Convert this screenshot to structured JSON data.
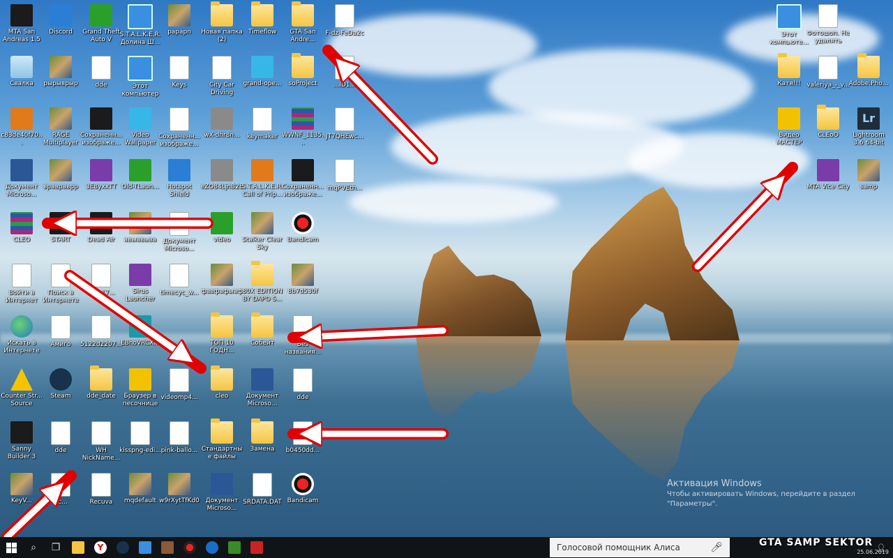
{
  "desktop": {
    "icons_left": [
      {
        "label": "MTA San Andreas 1.5",
        "glyph": "g-dark"
      },
      {
        "label": "Discord",
        "glyph": "g-blue"
      },
      {
        "label": "Grand Theft Auto V",
        "glyph": "g-green"
      },
      {
        "label": "S.T.A.L.K.E.R. Долина Ш...",
        "glyph": "g-monitor"
      },
      {
        "label": "papapn",
        "glyph": "g-img"
      },
      {
        "label": "Новая папка (2)",
        "glyph": "g-folder"
      },
      {
        "label": "Timeflow",
        "glyph": "g-folder"
      },
      {
        "label": "GTA San Andre...",
        "glyph": "g-folder"
      },
      {
        "label": "F-dz-FeDa2c",
        "glyph": "g-file"
      },
      {
        "label": "Свалка",
        "glyph": "g-recycle"
      },
      {
        "label": "рырыврыр",
        "glyph": "g-img"
      },
      {
        "label": "dde",
        "glyph": "g-file"
      },
      {
        "label": "Этот компьютер",
        "glyph": "g-monitor"
      },
      {
        "label": "Keys",
        "glyph": "g-file"
      },
      {
        "label": "City Car Driving",
        "glyph": "g-file"
      },
      {
        "label": "grand-ope...",
        "glyph": "g-cyan"
      },
      {
        "label": "soProject",
        "glyph": "g-folder"
      },
      {
        "label": "...ID1...",
        "glyph": "g-file"
      },
      {
        "label": "c83de40f70...",
        "glyph": "g-orange"
      },
      {
        "label": "RAGE Multiplayer",
        "glyph": "g-img"
      },
      {
        "label": "Сохраненн... изображе...",
        "glyph": "g-dark"
      },
      {
        "label": "Video Wallpaper",
        "glyph": "g-cyan"
      },
      {
        "label": "Сохраненн... изображе...",
        "glyph": "g-file"
      },
      {
        "label": "wX-dhr8n...",
        "glyph": "g-gray"
      },
      {
        "label": "keymaker",
        "glyph": "g-file"
      },
      {
        "label": "WWNF_1135...",
        "glyph": "g-winrar"
      },
      {
        "label": "JT7QHEwc...",
        "glyph": "g-file"
      },
      {
        "label": "Документ Microso...",
        "glyph": "g-word"
      },
      {
        "label": "вравраврр",
        "glyph": "g-img"
      },
      {
        "label": "3E8yxxTT",
        "glyph": "g-purple"
      },
      {
        "label": "Old-TLaun...",
        "glyph": "g-green"
      },
      {
        "label": "Hotspot Shield",
        "glyph": "g-blue"
      },
      {
        "label": "eZO84LjnB2E",
        "glyph": "g-gray"
      },
      {
        "label": "S.T.A.L.K.E.R. Call of Prip...",
        "glyph": "g-orange"
      },
      {
        "label": "Сохраненн... изображе...",
        "glyph": "g-dark"
      },
      {
        "label": "rnqPVEth...",
        "glyph": "g-file"
      },
      {
        "label": "CLEO",
        "glyph": "g-winrar"
      },
      {
        "label": "START",
        "glyph": "g-dark"
      },
      {
        "label": "Dead Air",
        "glyph": "g-dark"
      },
      {
        "label": "авыавыва",
        "glyph": "g-img"
      },
      {
        "label": "Документ Microso...",
        "glyph": "g-file"
      },
      {
        "label": "video",
        "glyph": "g-green"
      },
      {
        "label": "Stalker Clear Sky",
        "glyph": "g-img"
      },
      {
        "label": "Bandicam",
        "glyph": "g-bandicam"
      },
      {
        "label": "Войти в Интернет",
        "glyph": "g-file"
      },
      {
        "label": "Поиск в Интернете",
        "glyph": "g-file"
      },
      {
        "label": "Sh...17...",
        "glyph": "g-file"
      },
      {
        "label": "Sirus Launcher",
        "glyph": "g-purple"
      },
      {
        "label": "timecyc_w...",
        "glyph": "g-file"
      },
      {
        "label": "фавфафыаф",
        "glyph": "g-img"
      },
      {
        "label": "80X EDITION BY DAPO S...",
        "glyph": "g-folder"
      },
      {
        "label": "8b7d530f",
        "glyph": "g-img"
      },
      {
        "label": "Искать в Интернете",
        "glyph": "g-globe"
      },
      {
        "label": "Амиго",
        "glyph": "g-file"
      },
      {
        "label": "5122d2207...",
        "glyph": "g-file"
      },
      {
        "label": "EBhoVRCX...",
        "glyph": "g-teal"
      },
      {
        "label": "ТОП 10 ГОДН...",
        "glyph": "g-folder"
      },
      {
        "label": "Собейт",
        "glyph": "g-folder"
      },
      {
        "label": "Без названия...",
        "glyph": "g-file"
      },
      {
        "label": "Counter Str... Source",
        "glyph": "g-warn"
      },
      {
        "label": "Steam",
        "glyph": "g-steam"
      },
      {
        "label": "dde_date",
        "glyph": "g-folder"
      },
      {
        "label": "Браузер в песочнице",
        "glyph": "g-yellow"
      },
      {
        "label": "videomp4...",
        "glyph": "g-file"
      },
      {
        "label": "cleo",
        "glyph": "g-folder"
      },
      {
        "label": "Документ Microso...",
        "glyph": "g-word"
      },
      {
        "label": "dde",
        "glyph": "g-aiff"
      },
      {
        "label": "Sanny Builder 3",
        "glyph": "g-dark"
      },
      {
        "label": "dde",
        "glyph": "g-file"
      },
      {
        "label": "WH NickName...",
        "glyph": "g-file"
      },
      {
        "label": "kisspng-edi...",
        "glyph": "g-file"
      },
      {
        "label": "pink-ballo...",
        "glyph": "g-file"
      },
      {
        "label": "Стандартные файлы",
        "glyph": "g-folder"
      },
      {
        "label": "Замена",
        "glyph": "g-folder"
      },
      {
        "label": "b0450dd...",
        "glyph": "g-file"
      },
      {
        "label": "KeyV...",
        "glyph": "g-img"
      },
      {
        "label": "dc...",
        "glyph": "g-file"
      },
      {
        "label": "Recuva",
        "glyph": "g-file"
      },
      {
        "label": "mqdefault",
        "glyph": "g-img"
      },
      {
        "label": "w9rXytTfKd0",
        "glyph": "g-img"
      },
      {
        "label": "Документ Microso...",
        "glyph": "g-word"
      },
      {
        "label": "SRDATA.DAT",
        "glyph": "g-file"
      },
      {
        "label": "Bandicam",
        "glyph": "g-bandicam"
      }
    ],
    "icons_right": [
      {
        "label": "Этот компьюте...",
        "glyph": "g-monitor"
      },
      {
        "label": "Фотошоп. Не удалять",
        "glyph": "g-file"
      },
      {
        "label": "Катя!!!",
        "glyph": "g-folder"
      },
      {
        "label": "valeriya_-_v...",
        "glyph": "g-file"
      },
      {
        "label": "Adobe.Pho...",
        "glyph": "g-folder"
      },
      {
        "label": "Видео МАСТЕР",
        "glyph": "g-yellow"
      },
      {
        "label": "CLEoO",
        "glyph": "g-folder"
      },
      {
        "label": "Lightroom 3.6 64-bit",
        "glyph": "g-lr"
      },
      {
        "label": "MTA Vice City",
        "glyph": "g-purple"
      },
      {
        "label": "samp",
        "glyph": "g-img"
      }
    ],
    "lr_text": "Lr"
  },
  "activation": {
    "title": "Активация Windows",
    "line1": "Чтобы активировать Windows, перейдите в раздел",
    "line2": "\"Параметры\"."
  },
  "taskbar": {
    "search_text": "Голосовой помощник Алиса",
    "watermark": "GTA SAMP SEKTOR",
    "date": "25.06.2019"
  }
}
